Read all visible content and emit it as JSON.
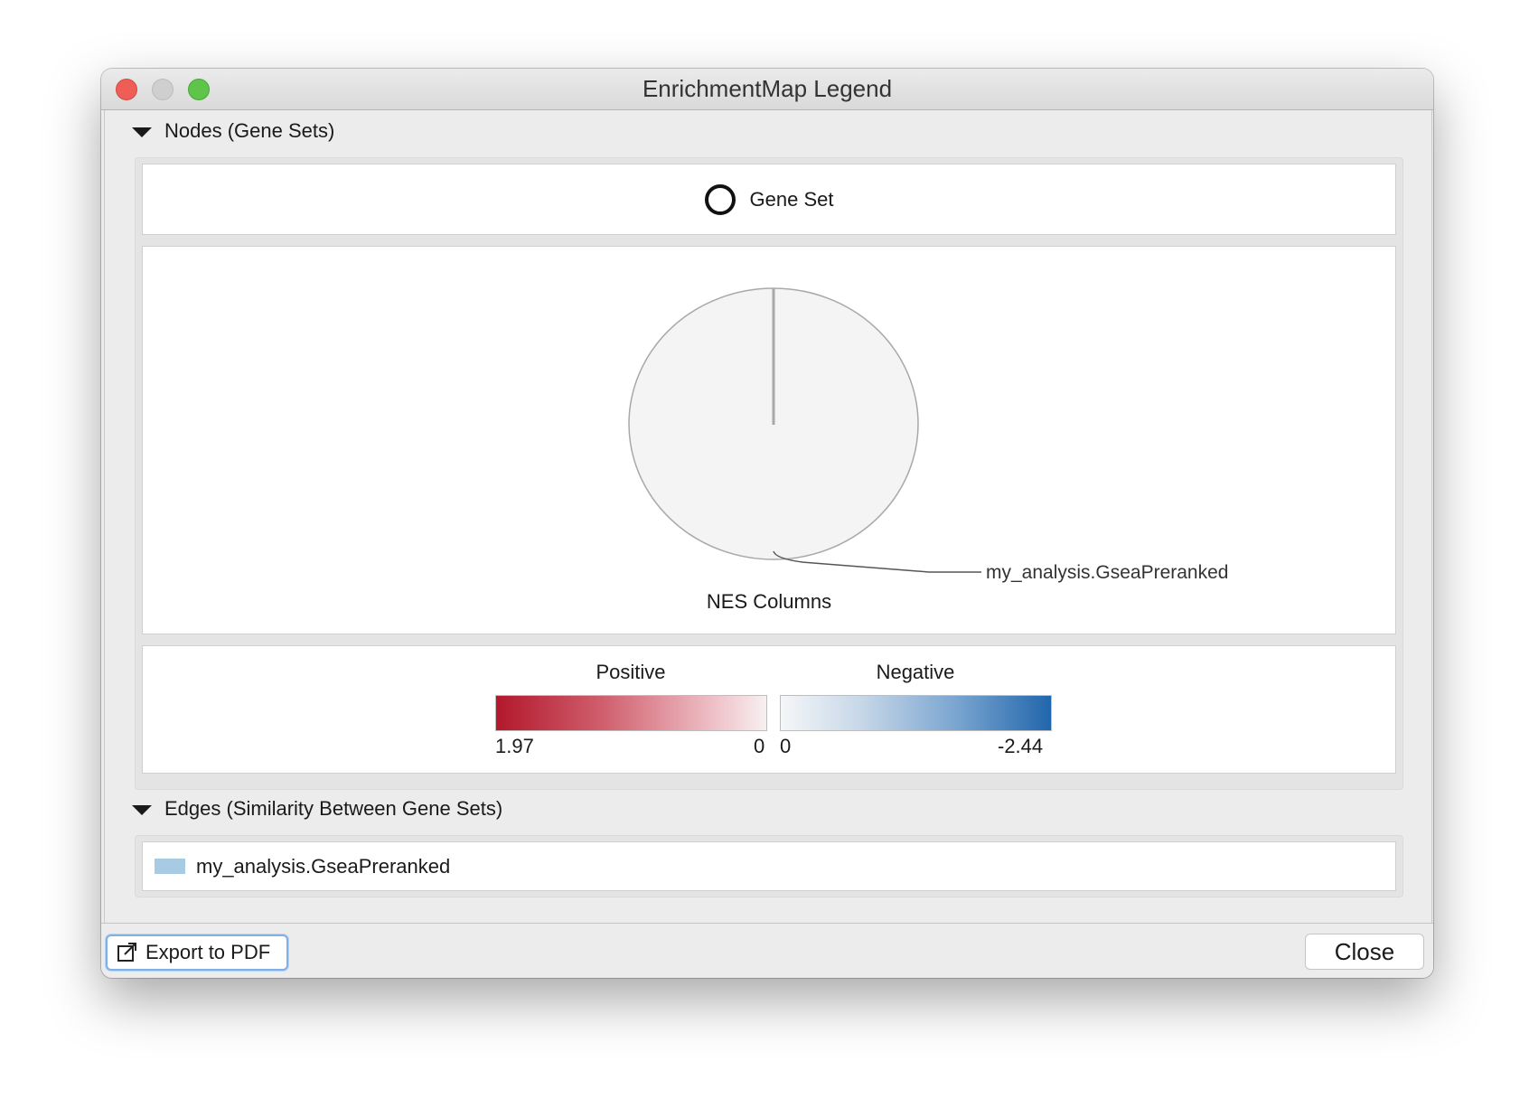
{
  "window": {
    "title": "EnrichmentMap Legend"
  },
  "nodes_section": {
    "header": "Nodes (Gene Sets)",
    "gene_set_label": "Gene Set",
    "pie_series_label": "my_analysis.GseaPreranked",
    "nes_title": "NES Columns",
    "positive": {
      "label": "Positive",
      "max_label": "1.97",
      "min_label": "0",
      "color_start": "#b2182b",
      "color_end": "#f7f7f7"
    },
    "negative": {
      "label": "Negative",
      "min_label": "0",
      "max_label": "-2.44",
      "color_start": "#f7f7f7",
      "color_end": "#2166ac"
    }
  },
  "edges_section": {
    "header": "Edges (Similarity Between Gene Sets)",
    "items": [
      {
        "label": "my_analysis.GseaPreranked",
        "color": "#a6cbe3"
      }
    ]
  },
  "footer": {
    "export_label": "Export to PDF",
    "export_icon": "external-link-icon",
    "close_label": "Close"
  }
}
